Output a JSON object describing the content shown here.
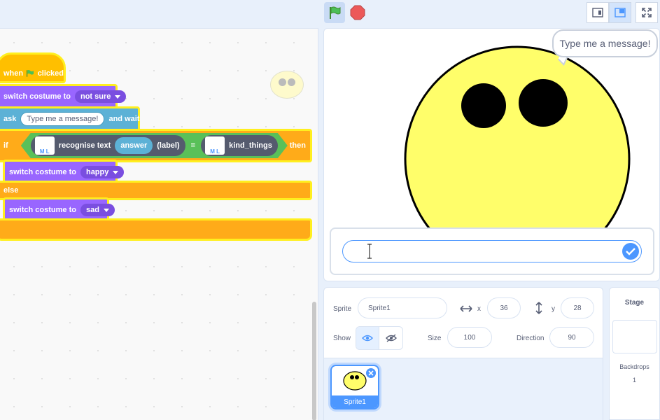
{
  "topbar": {
    "green_flag_icon": "green-flag-icon",
    "stop_icon": "stop-sign-icon",
    "modes": [
      "small-stage-icon",
      "normal-stage-icon",
      "fullscreen-icon"
    ]
  },
  "code": {
    "hat": {
      "when": "when",
      "clicked": "clicked"
    },
    "switch1": {
      "label": "switch costume to",
      "value": "not sure"
    },
    "ask": {
      "label": "ask",
      "input": "Type me a message!",
      "and_wait": "and wait"
    },
    "if_block": {
      "if_label": "if",
      "then_label": "then",
      "recognise": "recognise text",
      "answer": "answer",
      "label": "(label)",
      "equals": "=",
      "kind_things": "kind_things"
    },
    "switch2": {
      "label": "switch costume to",
      "value": "happy"
    },
    "else_label": "else",
    "switch3": {
      "label": "switch costume to",
      "value": "sad"
    }
  },
  "stage": {
    "speech": "Type me a message!",
    "ask_input_value": ""
  },
  "sprite_info": {
    "sprite_label": "Sprite",
    "sprite_name": "Sprite1",
    "x_label": "x",
    "x_value": "36",
    "y_label": "y",
    "y_value": "28",
    "show_label": "Show",
    "size_label": "Size",
    "size_value": "100",
    "direction_label": "Direction",
    "direction_value": "90"
  },
  "sprites": [
    {
      "name": "Sprite1"
    }
  ],
  "stage_pane": {
    "title": "Stage",
    "backdrops_label": "Backdrops",
    "backdrops_count": "1"
  },
  "colors": {
    "accent": "#4c97ff",
    "events": "#ffbf00",
    "looks": "#9966ff",
    "sensing": "#5cb1d6",
    "control": "#ffab19",
    "ml": "#59c059"
  }
}
